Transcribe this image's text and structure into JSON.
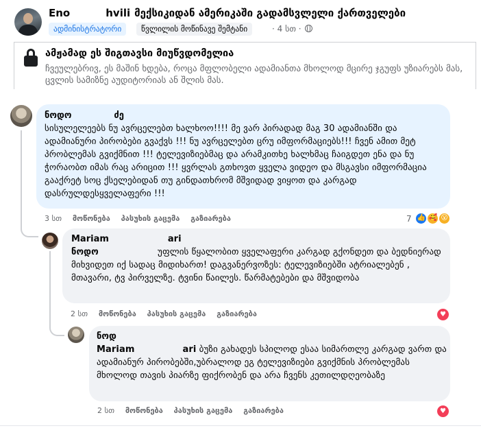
{
  "post": {
    "author_first": "Eno",
    "author_last": "hvili",
    "group": "მექსიკიდან ამერიკაში გადამსვლელი ქართველები",
    "admin_badge": "ადმინისტრატორი",
    "member_badge": "წვლილის მოწინავე შემტანი",
    "time": "· 4 სთ ·",
    "globe_icon": "globe-icon"
  },
  "attachment": {
    "lock_icon": "lock-icon",
    "title": "ამჟამად ეს შიგთავსი მიუწვდომელია",
    "description": "ჩვეულებრივ, ეს მაშინ ხდება, როცა მფლობელი ადამიანთა მხოლოდ მცირე ჯგუფს უზიარებს მას, ცვლის სამიზნე აუდიტორიას ან შლის მას."
  },
  "comments": [
    {
      "author_first": "ნოდო",
      "author_last": "ძე",
      "text": "სისულელეებს ნუ ავრცელებთ ხალხოო!!!! მე ვარ პირადად მაგ 30 ადამიანში და ადამიანური პირობები გვაქვს !!! ნუ ავრცელებთ ცრუ იმფორმაციებს!!! ჩვენ ამით მეტ პრობლემას გვიქმნით !!! ტელევიზიებმაც და არამკითხე ხალხმაც ჩაიგდეთ ენა და ნუ ჭორაობთ იმას რაც არიცით !!! ყვრლას გთხოვთ ყველა ვიდეო და მსგავსი იმფორმაცია გააქრეტ სოც ქსელებიდან თუ გინდათხრომ მშვიდად ვიყოთ და კარგად დასრულდესყველაფერი !!!",
      "time": "3 სთ",
      "like": "მოწონება",
      "reply": "პასუხის გაცემა",
      "share": "გაზიარება",
      "reaction_count": "7"
    },
    {
      "author_first": "Mariam",
      "author_last": "ari",
      "mention": "ნოდო",
      "text": " უფლის წყალობით ყველაფერი კარგად გქონდეთ და ბედნიერად მიხვიდეთ იქ სადაც მიდიხართ! დაგვანერვოზეს: ტელევიზიებში ატრიალებენ , მთავარი, ტვ პირველზე. ტვინი წაილეს. წარმატებები და მშვიდობა",
      "time": "2 სთ",
      "like": "მოწონება",
      "reply": "პასუხის გაცემა",
      "share": "გაზიარება"
    },
    {
      "author_first": "ნოდ",
      "mention_first": "Mariam",
      "mention_last": "ari",
      "text": " ბუზი გახადეს სპილოდ ესაა სიმართლე კარგად ვართ და ადამიანურ პირობებში,უბრალოდ ეგ ტელევიზიები გვიქმნის პრობლემას მხოლოდ თავის პიარზე ფიქრობენ და არა ჩვენს კეთილდღეობაზე",
      "time": "2 სთ",
      "like": "მოწონება",
      "reply": "პასუხის გაცემა",
      "share": "გაზიარება"
    }
  ],
  "colors": {
    "accent": "#1b74e4",
    "bubble": "#f0f2f5",
    "highlight_bubble": "#e7f3ff",
    "heart": "#f33e58"
  }
}
